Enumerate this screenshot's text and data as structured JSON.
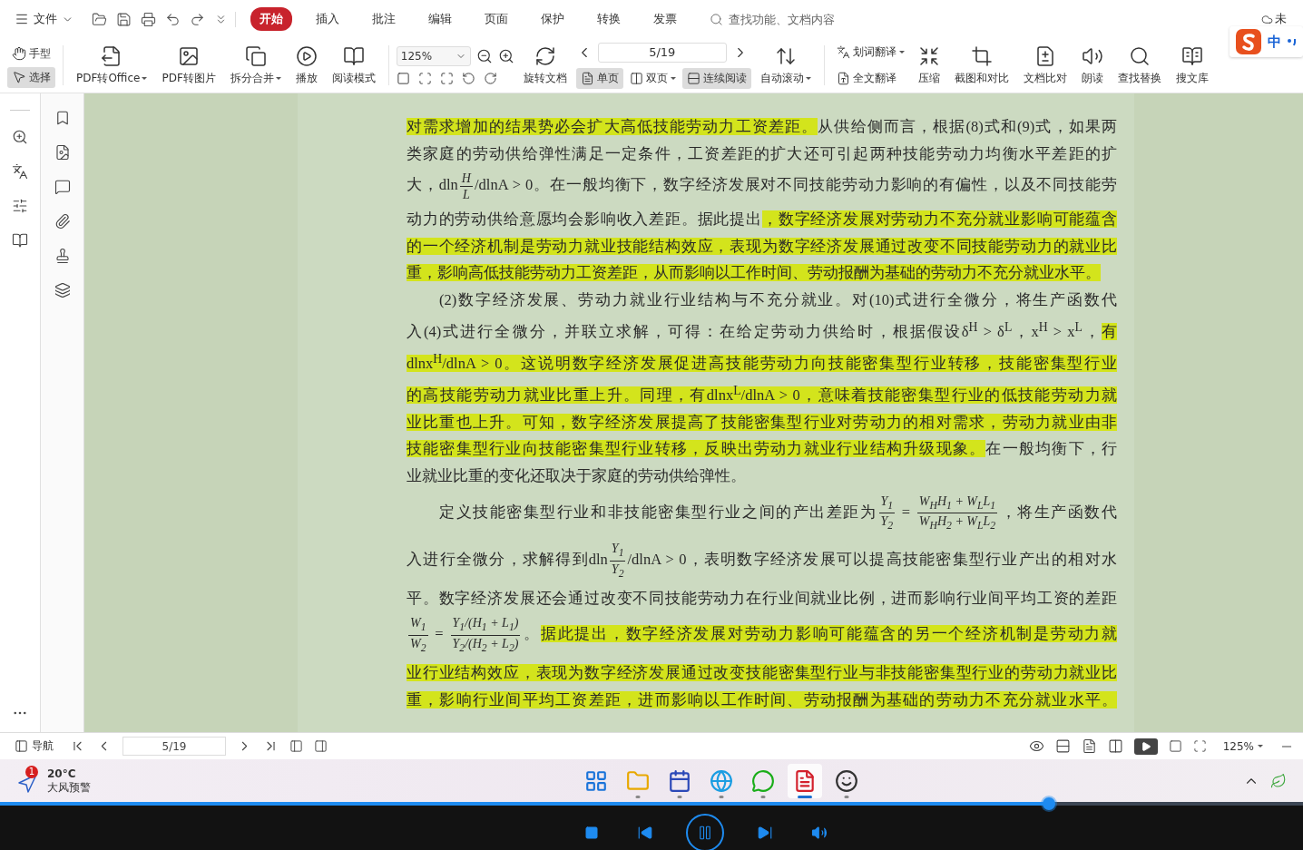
{
  "menu_bar": {
    "file_menu": "文件",
    "tabs": [
      {
        "label": "开始",
        "selected": true
      },
      {
        "label": "插入",
        "selected": false
      },
      {
        "label": "批注",
        "selected": false
      },
      {
        "label": "编辑",
        "selected": false
      },
      {
        "label": "页面",
        "selected": false
      },
      {
        "label": "保护",
        "selected": false
      },
      {
        "label": "转换",
        "selected": false
      },
      {
        "label": "发票",
        "selected": false
      }
    ],
    "search": {
      "placeholder": "查找功能、文档内容"
    },
    "cloud_label": "未"
  },
  "ime": {
    "mode": "中"
  },
  "ribbon": {
    "hand_tools": [
      {
        "label": "手型",
        "selected": false
      },
      {
        "label": "选择",
        "selected": true
      }
    ],
    "convert_buttons": [
      {
        "label": "PDF转Office",
        "dropdown": true
      },
      {
        "label": "PDF转图片",
        "dropdown": false
      },
      {
        "label": "拆分合并",
        "dropdown": true
      },
      {
        "label": "播放",
        "dropdown": false
      },
      {
        "label": "阅读模式",
        "dropdown": false
      }
    ],
    "zoom": "125%",
    "rotate": "旋转文档",
    "page": "5/19",
    "view_modes": [
      {
        "label": "单页",
        "selected": true,
        "dropdown": false
      },
      {
        "label": "双页",
        "selected": false,
        "dropdown": true
      },
      {
        "label": "连续阅读",
        "selected": true,
        "dropdown": false
      }
    ],
    "auto_scroll": {
      "label": "自动滚动",
      "dropdown": true
    },
    "translate": [
      {
        "label": "划词翻译",
        "dropdown": true
      },
      {
        "label": "全文翻译",
        "dropdown": false
      }
    ],
    "tool_buttons": [
      {
        "label": "压缩"
      },
      {
        "label": "截图和对比"
      },
      {
        "label": "文档比对"
      },
      {
        "label": "朗读"
      },
      {
        "label": "查找替换"
      },
      {
        "label": "搜文库"
      }
    ]
  },
  "document": {
    "lines": [
      {
        "indent": false,
        "segments": [
          {
            "kind": "text",
            "text": "对需求增加的结果势必会扩大高低技能劳动力工资差距。",
            "highlighted": true
          },
          {
            "kind": "text",
            "text": "从供给侧而言，根据(8)式和(9)式，如果两",
            "highlighted": false
          }
        ]
      },
      {
        "indent": false,
        "segments": [
          {
            "kind": "text",
            "text": "类家庭的劳动供给弹性满足一定条件，工资差距的扩大还可引起两种技能劳动力均衡水平差距的扩",
            "highlighted": false
          }
        ]
      },
      {
        "indent": false,
        "segments": [
          {
            "kind": "text",
            "text": "大，dln",
            "highlighted": false
          },
          {
            "kind": "frac",
            "num": "H",
            "den": "L"
          },
          {
            "kind": "text",
            "text": "/dlnA > 0。在一般均衡下，数字经济发展对不同技能劳动力影响的有偏性，以及不同技能劳",
            "highlighted": false
          }
        ]
      },
      {
        "indent": false,
        "segments": [
          {
            "kind": "text",
            "text": "动力的劳动供给意愿均会影响收入差距。据此提出",
            "highlighted": false
          },
          {
            "kind": "text",
            "text": "，数字经济发展对劳动力不充分就业影响可能蕴含",
            "highlighted": true
          }
        ]
      },
      {
        "indent": false,
        "segments": [
          {
            "kind": "text",
            "text": "的一个经济机制是劳动力就业技能结构效应，表现为数字经济发展通过改变不同技能劳动力的就业比",
            "highlighted": true
          }
        ]
      },
      {
        "indent": false,
        "segments": [
          {
            "kind": "text",
            "text": "重，影响高低技能劳动力工资差距，从而影响以工作时间、劳动报酬为基础的劳动力不充分就业水平。",
            "highlighted": true
          }
        ]
      },
      {
        "indent": true,
        "segments": [
          {
            "kind": "text",
            "text": "(2)数字经济发展、劳动力就业行业结构与不充分就业。对(10)式进行全微分，将生产函数代",
            "highlighted": false
          }
        ]
      },
      {
        "indent": false,
        "segments": [
          {
            "kind": "text",
            "text": "入(4)式进行全微分，并联立求解，可得：在给定劳动力供给时，根据假设δ$^{H}$ > δ$^{L}$，x$^{H}$ > x$^{L}$，",
            "highlighted": false
          },
          {
            "kind": "text",
            "text": "有",
            "highlighted": true
          }
        ]
      },
      {
        "indent": false,
        "segments": [
          {
            "kind": "text",
            "text": "dlnx$^{H}$/dlnA > 0。这说明数字经济发展促进高技能劳动力向技能密集型行业转移，技能密集型行业",
            "highlighted": true
          }
        ]
      },
      {
        "indent": false,
        "segments": [
          {
            "kind": "text",
            "text": "的高技能劳动力就业比重上升。同理，有dlnx$^{L}$/dlnA > 0，意味着技能密集型行业的低技能劳动力就",
            "highlighted": true
          }
        ]
      },
      {
        "indent": false,
        "segments": [
          {
            "kind": "text",
            "text": "业比重也上升。可知，数字经济发展提高了技能密集型行业对劳动力的相对需求，劳动力就业由非",
            "highlighted": true
          }
        ]
      },
      {
        "indent": false,
        "segments": [
          {
            "kind": "text",
            "text": "技能密集型行业向技能密集型行业转移，反映出劳动力就业行业结构升级现象。",
            "highlighted": true
          },
          {
            "kind": "text",
            "text": "在一般均衡下，行",
            "highlighted": false
          }
        ]
      },
      {
        "indent": false,
        "segments": [
          {
            "kind": "text",
            "text": "业就业比重的变化还取决于家庭的劳动供给弹性。",
            "highlighted": false
          }
        ]
      },
      {
        "indent": true,
        "segments": [
          {
            "kind": "text",
            "text": "定义技能密集型行业和非技能密集型行业之间的产出差距为",
            "highlighted": false
          },
          {
            "kind": "frac",
            "num": "Y$_{1}$",
            "den": "Y$_{2}$"
          },
          {
            "kind": "text",
            "text": " = ",
            "highlighted": false
          },
          {
            "kind": "frac",
            "num": "W$_{H}$H$_{1}$ + W$_{L}$L$_{1}$",
            "den": "W$_{H}$H$_{2}$ + W$_{L}$L$_{2}$"
          },
          {
            "kind": "text",
            "text": "，将生产函数代",
            "highlighted": false
          }
        ]
      },
      {
        "indent": false,
        "segments": [
          {
            "kind": "text",
            "text": "入进行全微分，求解得到dln",
            "highlighted": false
          },
          {
            "kind": "frac",
            "num": "Y$_{1}$",
            "den": "Y$_{2}$"
          },
          {
            "kind": "text",
            "text": "/dlnA > 0，表明数字经济发展可以提高技能密集型行业产出的相对水",
            "highlighted": false
          }
        ]
      },
      {
        "indent": false,
        "segments": [
          {
            "kind": "text",
            "text": "平。数字经济发展还会通过改变不同技能劳动力在行业间就业比例，进而影响行业间平均工资的差距",
            "highlighted": false
          }
        ]
      },
      {
        "indent": false,
        "segments": [
          {
            "kind": "frac",
            "num": "W$_{1}$",
            "den": "W$_{2}$"
          },
          {
            "kind": "text",
            "text": " = ",
            "highlighted": false
          },
          {
            "kind": "frac",
            "num": "Y$_{1}$/(H$_{1}$ + L$_{1}$)",
            "den": "Y$_{2}$/(H$_{2}$ + L$_{2}$)"
          },
          {
            "kind": "text",
            "text": "。",
            "highlighted": false
          },
          {
            "kind": "text",
            "text": "据此提出，数字经济发展对劳动力影响可能蕴含的另一个经济机制是劳动力就",
            "highlighted": true
          }
        ]
      },
      {
        "indent": false,
        "segments": [
          {
            "kind": "text",
            "text": "业行业结构效应，表现为数字经济发展通过改变技能密集型行业与非技能密集型行业的劳动力就业比",
            "highlighted": true
          }
        ]
      },
      {
        "indent": false,
        "segments": [
          {
            "kind": "text",
            "text": "重，影响行业间平均工资差距，进而影响以工作时间、劳动报酬为基础的劳动力不充分就业水平。",
            "highlighted": true
          }
        ]
      }
    ]
  },
  "status_bar": {
    "nav_label": "导航",
    "page": "5/19",
    "zoom": "125%"
  },
  "taskbar": {
    "weather": {
      "badge": "1",
      "temperature": "20°C",
      "alert": "大风预警"
    },
    "apps": [
      {
        "running": false,
        "active": false
      },
      {
        "running": true,
        "active": false
      },
      {
        "running": true,
        "active": false
      },
      {
        "running": true,
        "active": false
      },
      {
        "running": true,
        "active": false
      },
      {
        "running": true,
        "active": true
      },
      {
        "running": true,
        "active": false
      }
    ]
  },
  "player": {
    "progress": {
      "level": 0.805
    },
    "playing": true
  }
}
